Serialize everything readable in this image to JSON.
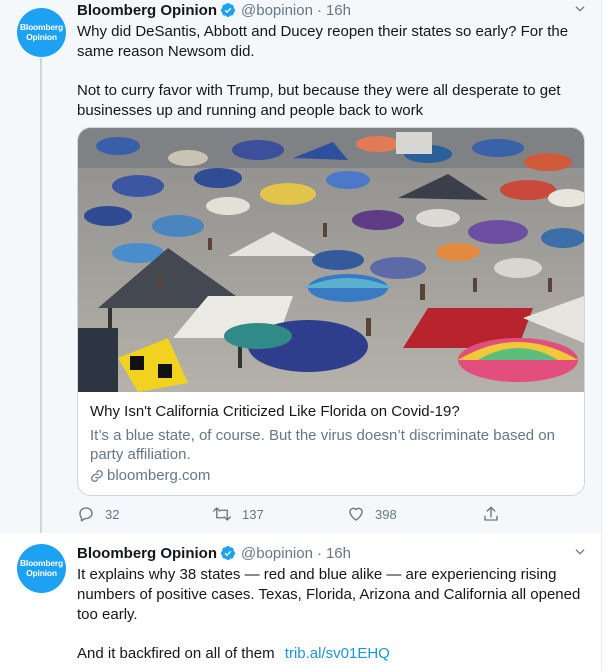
{
  "tweets": [
    {
      "author": {
        "display_name": "Bloomberg Opinion",
        "handle": "@bopinion",
        "avatar_line1": "Bloomberg",
        "avatar_line2": "Opinion",
        "verified": true
      },
      "time": "16h",
      "dot": "·",
      "paragraphs": [
        "Why did DeSantis, Abbott and Ducey reopen their states so early? For the same reason Newsom did.",
        "Not to curry favor with Trump, but because they were all desperate to get businesses up and running and people back to work"
      ],
      "card": {
        "title": "Why Isn't California Criticized Like Florida on Covid-19?",
        "description": "It’s a blue state, of course. But the virus doesn’t discriminate based on party affiliation.",
        "domain": "bloomberg.com",
        "image_icon": "beach-crowd-photo"
      },
      "actions": {
        "replies": "32",
        "retweets": "137",
        "likes": "398"
      }
    },
    {
      "author": {
        "display_name": "Bloomberg Opinion",
        "handle": "@bopinion",
        "avatar_line1": "Bloomberg",
        "avatar_line2": "Opinion",
        "verified": true
      },
      "time": "16h",
      "dot": "·",
      "paragraphs": [
        "It explains why 38 states — red and blue alike — are experiencing rising numbers of positive cases. Texas, Florida, Arizona and California all opened too early."
      ],
      "last_line_text": "And it backfired on all of them",
      "last_line_link": "trib.al/sv01EHQ"
    }
  ],
  "colors": {
    "accent": "#1da1f2",
    "link": "#1b95e0",
    "secondary_text": "#657786",
    "thread_background": "#f5f8fa"
  }
}
